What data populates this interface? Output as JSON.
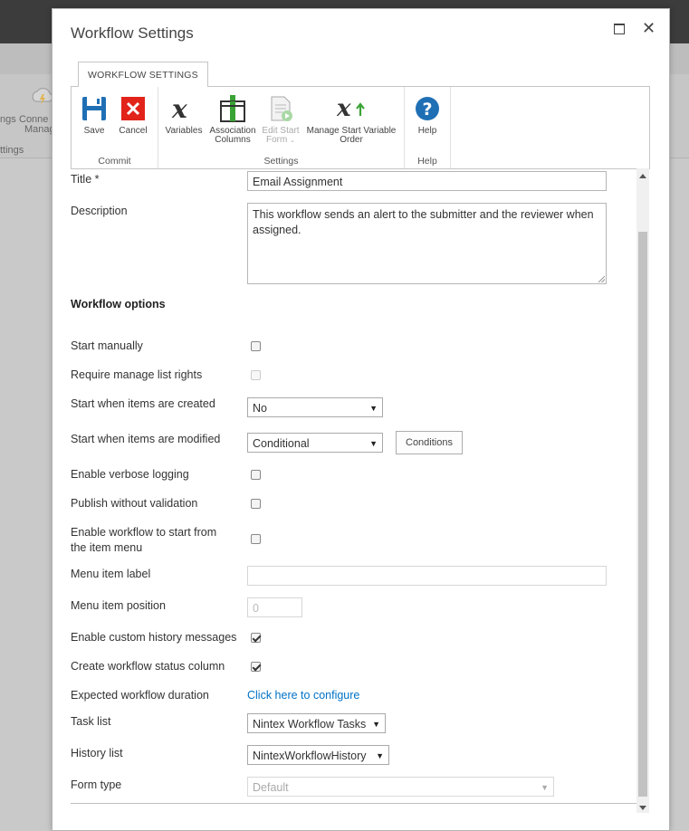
{
  "background": {
    "frag_settings": "ngs",
    "frag_connect": "Conne",
    "frag_manag": "Manag",
    "frag_group": "ttings"
  },
  "dialog": {
    "title": "Workflow Settings"
  },
  "ribbon": {
    "tab": "WORKFLOW SETTINGS",
    "groups": {
      "commit": "Commit",
      "settings": "Settings",
      "help": "Help"
    },
    "buttons": {
      "save": "Save",
      "cancel": "Cancel",
      "variables": "Variables",
      "association_columns_1": "Association",
      "association_columns_2": "Columns",
      "edit_start_form_1": "Edit Start",
      "edit_start_form_2": "Form",
      "manage_start_variable_order_1": "Manage Start Variable",
      "manage_start_variable_order_2": "Order",
      "help": "Help"
    }
  },
  "form": {
    "title_label": "Title *",
    "title_value": "Email Assignment",
    "description_label": "Description",
    "description_value": "This workflow sends an alert to the submitter and the reviewer when assigned.",
    "workflow_options_heading": "Workflow options",
    "start_manually": "Start manually",
    "require_manage_list_rights": "Require manage list rights",
    "start_when_created_label": "Start when items are created",
    "start_when_created_value": "No",
    "start_when_modified_label": "Start when items are modified",
    "start_when_modified_value": "Conditional",
    "conditions_button": "Conditions",
    "enable_verbose_logging": "Enable verbose logging",
    "publish_without_validation": "Publish without validation",
    "enable_item_menu_1": "Enable workflow to start from",
    "enable_item_menu_2": "the item menu",
    "menu_item_label": "Menu item label",
    "menu_item_label_value": "",
    "menu_item_position": "Menu item position",
    "menu_item_position_placeholder": "0",
    "enable_custom_history": "Enable custom history messages",
    "create_status_column": "Create workflow status column",
    "expected_duration_label": "Expected workflow duration",
    "expected_duration_link": "Click here to configure",
    "task_list_label": "Task list",
    "task_list_value": "Nintex Workflow Tasks",
    "history_list_label": "History list",
    "history_list_value": "NintexWorkflowHistory",
    "form_type_label": "Form type",
    "form_type_value": "Default"
  },
  "colors": {
    "save_blue": "#1f6fb5",
    "cancel_red": "#e2231a",
    "help_blue": "#1f6fb5",
    "link_blue": "#0072c6",
    "assoc_green": "#3aa335"
  }
}
